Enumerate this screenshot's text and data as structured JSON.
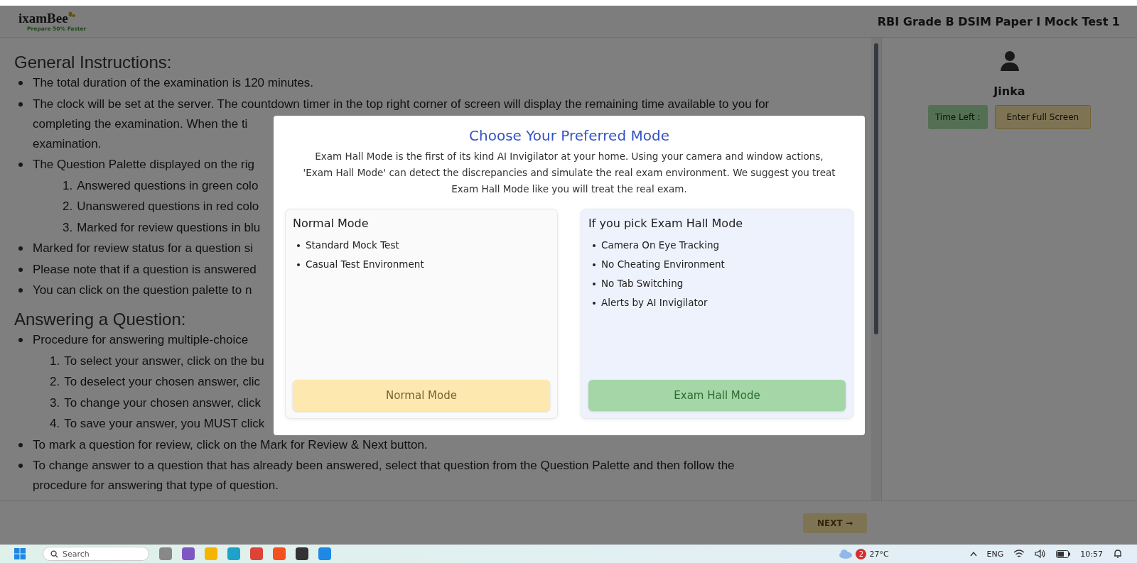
{
  "header": {
    "logo": {
      "name": "ixamBee",
      "tagline": "Prepare 50% Faster"
    },
    "title": "RBI Grade B DSIM Paper I Mock Test 1"
  },
  "sections": [
    {
      "heading": "General Instructions:",
      "items": [
        {
          "lines": [
            "The total duration of the examination is 120 minutes."
          ]
        },
        {
          "lines": [
            "The clock will be set at the server. The countdown timer in the top right corner of screen will display the remaining time available to you for",
            "completing the examination. When the ti",
            "examination."
          ]
        },
        {
          "lines": [
            "The Question Palette displayed on the rig"
          ],
          "subitems": [
            {
              "number": "1.",
              "text": "Answered questions in green colo"
            },
            {
              "number": "2.",
              "text": "Unanswered questions in red colo"
            },
            {
              "number": "3.",
              "text": "Marked for review questions in blu"
            }
          ]
        },
        {
          "lines": [
            "Marked for review status for a question si"
          ]
        },
        {
          "lines": [
            "Please note that if a question is answered"
          ]
        },
        {
          "lines": [
            "You can click on the question palette to n"
          ]
        }
      ]
    },
    {
      "heading": "Answering a Question:",
      "items": [
        {
          "lines": [
            "Procedure for answering multiple-choice"
          ],
          "subitems": [
            {
              "number": "1.",
              "text": "To select your answer, click on the bu"
            },
            {
              "number": "2.",
              "text": "To deselect your chosen answer, clic"
            },
            {
              "number": "3.",
              "text": "To change your chosen answer, click"
            },
            {
              "number": "4.",
              "text": "To save your answer, you MUST click"
            }
          ]
        },
        {
          "lines": [
            "To mark a question for review, click on the Mark for Review & Next  button."
          ]
        },
        {
          "lines": [
            "To change answer to a question that has already been answered, select that question from the Question Palette and then follow the",
            "procedure for answering that type of question."
          ]
        }
      ]
    }
  ],
  "side_panel": {
    "user_name": "Jinka",
    "time_left_label": "Time Left :",
    "fullscreen_button": "Enter Full Screen"
  },
  "footer": {
    "next_button": "NEXT →"
  },
  "modal": {
    "title": "Choose Your Preferred Mode",
    "description": "Exam Hall Mode is the first of its kind AI Invigilator at your home. Using your camera and window actions, 'Exam Hall Mode' can detect the discrepancies and simulate the real exam environment. We suggest you treat Exam Hall Mode like you will treat the real exam.",
    "options": [
      {
        "kind": "normal",
        "title": "Normal Mode",
        "features": [
          "Standard Mock Test",
          "Casual Test Environment"
        ],
        "button": "Normal Mode"
      },
      {
        "kind": "exam",
        "title": "If you pick Exam Hall Mode",
        "features": [
          "Camera On Eye Tracking",
          "No Cheating Environment",
          "No Tab Switching",
          "Alerts by AI Invigilator"
        ],
        "button": "Exam Hall Mode"
      }
    ]
  },
  "taskbar": {
    "search_placeholder": "Search",
    "weather_badge": "2",
    "temperature": "27°C",
    "language": "ENG",
    "time": "10:57"
  }
}
